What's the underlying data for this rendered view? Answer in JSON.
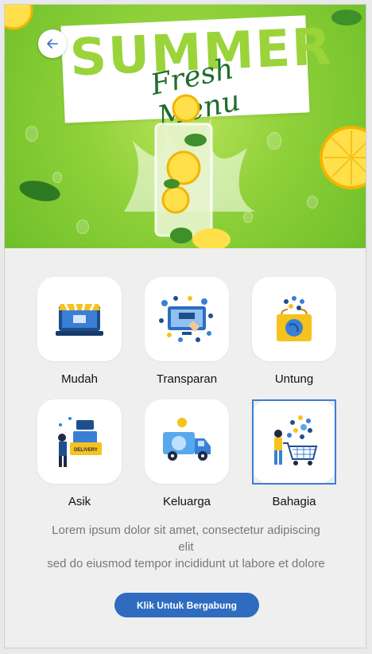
{
  "banner": {
    "title": "SUMMER",
    "subtitle": "Fresh Menu"
  },
  "features": [
    {
      "label": "Mudah",
      "icon": "laptop-shop-icon"
    },
    {
      "label": "Transparan",
      "icon": "digital-payment-icon"
    },
    {
      "label": "Untung",
      "icon": "shopping-bag-icon"
    },
    {
      "label": "Asik",
      "icon": "delivery-person-icon"
    },
    {
      "label": "Keluarga",
      "icon": "delivery-truck-icon"
    },
    {
      "label": "Bahagia",
      "icon": "shopping-cart-person-icon"
    }
  ],
  "selected_feature": "Bahagia",
  "description": {
    "line1": "Lorem ipsum dolor sit amet, consectetur adipiscing",
    "line2": "elit",
    "line3": "sed do eiusmod tempor incididunt ut labore et dolore"
  },
  "cta_label": "Klik Untuk Bergabung",
  "colors": {
    "accent": "#2f6cc0",
    "lime": "#8fd13a"
  }
}
